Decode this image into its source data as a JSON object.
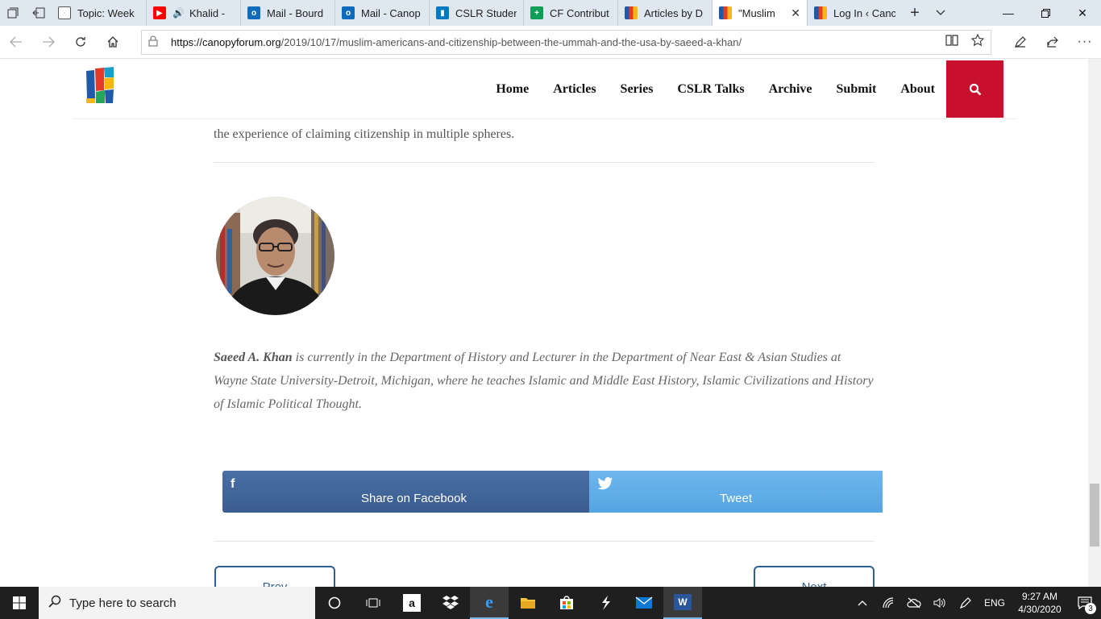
{
  "browser": {
    "tabs": [
      {
        "label": "Topic: Week",
        "favicon_color": "#555555",
        "icon": "page-icon"
      },
      {
        "label": "Khalid -",
        "favicon_color": "#ff0000",
        "icon": "youtube-icon"
      },
      {
        "label": "Mail - Bourd",
        "favicon_color": "#0f6cbd",
        "icon": "outlook-icon"
      },
      {
        "label": "Mail - Canop",
        "favicon_color": "#0f6cbd",
        "icon": "outlook-icon"
      },
      {
        "label": "CSLR Studen",
        "favicon_color": "#0079bf",
        "icon": "trello-icon"
      },
      {
        "label": "CF Contribut",
        "favicon_color": "#0f9d58",
        "icon": "sheets-icon"
      },
      {
        "label": "Articles by D",
        "favicon_color": "#2b7bb9",
        "icon": "canopy-icon"
      },
      {
        "label": "\"Muslim",
        "favicon_color": "#2b7bb9",
        "icon": "canopy-icon"
      },
      {
        "label": "Log In ‹ Canc",
        "favicon_color": "#2b7bb9",
        "icon": "canopy-icon"
      }
    ],
    "url_host": "https://canopyforum.org",
    "url_path": "/2019/10/17/muslim-americans-and-citizenship-between-the-ummah-and-the-usa-by-saeed-a-khan/"
  },
  "site": {
    "nav": [
      "Home",
      "Articles",
      "Series",
      "CSLR Talks",
      "Archive",
      "Submit",
      "About"
    ],
    "accent": "#c8102e"
  },
  "article": {
    "intro_tail": "the experience of claiming citizenship in multiple spheres.",
    "author_name": "Saeed A. Khan",
    "author_bio": " is currently in the Department of History and Lecturer in the Department of Near East & Asian Studies at Wayne State University-Detroit, Michigan, where he teaches Islamic and Middle East History, Islamic Civilizations and History of Islamic Political Thought.",
    "share_facebook": "Share on Facebook",
    "share_twitter": "Tweet",
    "prev": "Prev",
    "next": "Next"
  },
  "taskbar": {
    "search_placeholder": "Type here to search",
    "lang": "ENG",
    "time": "9:27 AM",
    "date": "4/30/2020",
    "notifications": "3"
  }
}
